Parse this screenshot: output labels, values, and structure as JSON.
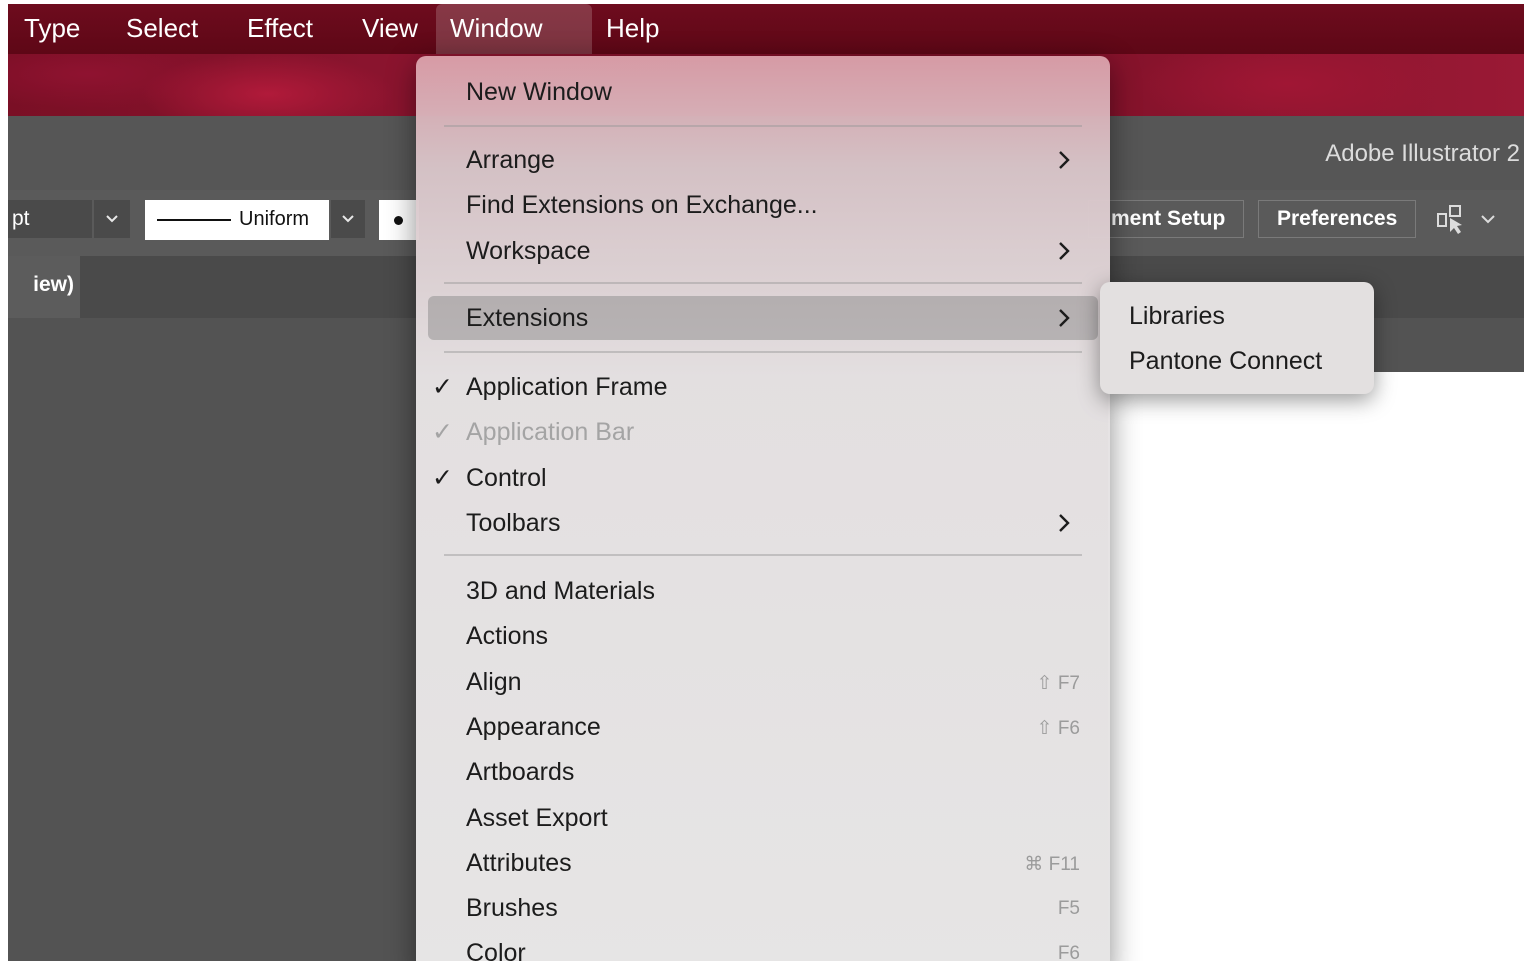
{
  "menubar": {
    "items": [
      "Type",
      "Select",
      "Effect",
      "View",
      "Window",
      "Help"
    ],
    "active": "Window"
  },
  "app": {
    "title": "Adobe Illustrator 2"
  },
  "control_bar": {
    "stroke_weight": "pt",
    "profile_label": "Uniform",
    "document_setup_label": "ment Setup",
    "preferences_label": "Preferences"
  },
  "tab": {
    "label": "iew)"
  },
  "window_menu": {
    "new_window": "New Window",
    "arrange": "Arrange",
    "find_extensions": "Find Extensions on Exchange...",
    "workspace": "Workspace",
    "extensions": "Extensions",
    "application_frame": "Application Frame",
    "application_bar": "Application Bar",
    "control": "Control",
    "toolbars": "Toolbars",
    "check_mark": "✓",
    "panels": [
      {
        "label": "3D and Materials",
        "shortcut": ""
      },
      {
        "label": "Actions",
        "shortcut": ""
      },
      {
        "label": "Align",
        "shortcut": "⇧ F7"
      },
      {
        "label": "Appearance",
        "shortcut": "⇧ F6"
      },
      {
        "label": "Artboards",
        "shortcut": ""
      },
      {
        "label": "Asset Export",
        "shortcut": ""
      },
      {
        "label": "Attributes",
        "shortcut": "⌘ F11"
      },
      {
        "label": "Brushes",
        "shortcut": "F5"
      },
      {
        "label": "Color",
        "shortcut": "F6"
      }
    ]
  },
  "extensions_submenu": {
    "items": [
      "Libraries",
      "Pantone Connect"
    ]
  },
  "colors": {
    "menubar_bg": "#6e0c1e",
    "app_chrome": "#565656",
    "workspace": "#535353",
    "menu_bg": "#e6e5e5",
    "highlight": "#a5a5a5"
  }
}
